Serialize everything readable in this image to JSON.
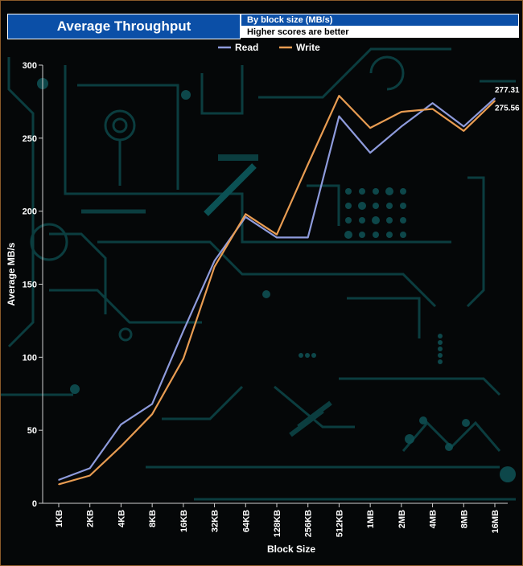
{
  "header": {
    "title": "Average Throughput",
    "subtitle": "By block size (MB/s)",
    "note": "Higher scores are better"
  },
  "colors": {
    "read": "#8e9bdc",
    "write": "#e89c52",
    "header_blue": "#0b4fa7",
    "circuit": "#0e4f52"
  },
  "chart_data": {
    "type": "line",
    "title": "Average Throughput",
    "subtitle": "By block size (MB/s)",
    "xlabel": "Block Size",
    "ylabel": "Average MB/s",
    "ylim": [
      0,
      300
    ],
    "yticks": [
      0,
      50,
      100,
      150,
      200,
      250,
      300
    ],
    "grid": false,
    "legend_position": "top-center",
    "categories": [
      "1KB",
      "2KB",
      "4KB",
      "8KB",
      "16KB",
      "32KB",
      "64KB",
      "128KB",
      "256KB",
      "512KB",
      "1MB",
      "2MB",
      "4MB",
      "8MB",
      "16MB"
    ],
    "series": [
      {
        "name": "Read",
        "color": "#8e9bdc",
        "values": [
          16,
          24,
          54,
          68,
          118,
          166,
          196,
          182,
          182,
          265,
          240,
          258,
          274,
          258,
          277.31
        ]
      },
      {
        "name": "Write",
        "color": "#e89c52",
        "values": [
          13,
          19,
          39,
          61,
          99,
          162,
          198,
          184,
          232,
          279,
          257,
          268,
          270,
          255,
          275.56
        ]
      }
    ],
    "data_labels": [
      {
        "series": "Read",
        "category": "16MB",
        "text": "277.31"
      },
      {
        "series": "Write",
        "category": "16MB",
        "text": "275.56"
      }
    ]
  }
}
